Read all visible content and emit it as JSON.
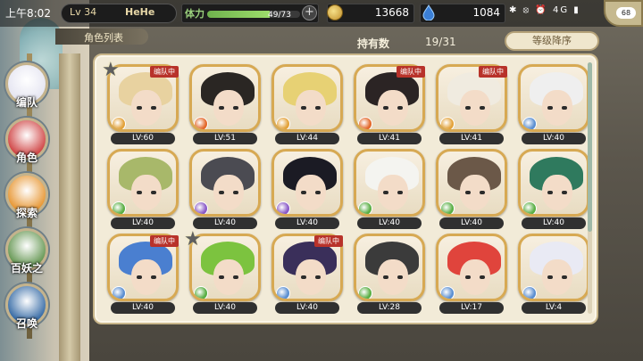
{
  "status_bar": {
    "time": "上午8:02",
    "indicators": "✱ ⦻ ⏰ 4G ▮",
    "battery": "68"
  },
  "player": {
    "level": "Lv 34",
    "name": "HeHe"
  },
  "stamina": {
    "label": "体力",
    "value": "49/73",
    "fraction": 0.67
  },
  "currency": {
    "gold": "13668",
    "gems": "1084"
  },
  "header": {
    "tab": "角色列表",
    "owned_label": "持有数",
    "owned_value": "19/31",
    "sort_button": "等级降序"
  },
  "sidebar": {
    "items": [
      {
        "label": "编队",
        "icon": "team-icon",
        "color": "#e6e6f2"
      },
      {
        "label": "角色",
        "icon": "character-icon",
        "color": "#d14a4a"
      },
      {
        "label": "探索",
        "icon": "explore-icon",
        "color": "#e89a3a"
      },
      {
        "label": "百妖之",
        "icon": "bestiary-icon",
        "color": "#6a9a58"
      },
      {
        "label": "召唤",
        "icon": "summon-icon",
        "color": "#3c6fa8"
      }
    ]
  },
  "characters": [
    {
      "level": "LV:60",
      "badge": "编队中",
      "hair": "#e8d2a0",
      "element": "#e3a23a",
      "frame": "#d7a953"
    },
    {
      "level": "LV:51",
      "badge": "",
      "hair": "#2a2623",
      "element": "#e3692b",
      "frame": "#d7a953"
    },
    {
      "level": "LV:44",
      "badge": "",
      "hair": "#e7d174",
      "element": "#e3a23a",
      "frame": "#d7a953"
    },
    {
      "level": "LV:41",
      "badge": "编队中",
      "hair": "#2b2424",
      "element": "#e3692b",
      "frame": "#d7a953"
    },
    {
      "level": "LV:41",
      "badge": "编队中",
      "hair": "#f0ebe0",
      "element": "#e3a23a",
      "frame": "#d7a953"
    },
    {
      "level": "LV:40",
      "badge": "",
      "hair": "#efefef",
      "element": "#5b8fd1",
      "frame": "#d7a953"
    },
    {
      "level": "LV:40",
      "badge": "",
      "hair": "#a8b86a",
      "element": "#5aaf45",
      "frame": "#d7a953"
    },
    {
      "level": "LV:40",
      "badge": "",
      "hair": "#4b4b52",
      "element": "#8a5ac7",
      "frame": "#d7a953"
    },
    {
      "level": "LV:40",
      "badge": "",
      "hair": "#1b1b24",
      "element": "#8a5ac7",
      "frame": "#d7a953"
    },
    {
      "level": "LV:40",
      "badge": "",
      "hair": "#f4f4f0",
      "element": "#5aaf45",
      "frame": "#d7a953"
    },
    {
      "level": "LV:40",
      "badge": "",
      "hair": "#6b5848",
      "element": "#5aaf45",
      "frame": "#d7a953"
    },
    {
      "level": "LV:40",
      "badge": "",
      "hair": "#2f7a5e",
      "element": "#5aaf45",
      "frame": "#d7a953"
    },
    {
      "level": "LV:40",
      "badge": "编队中",
      "hair": "#4a7fd0",
      "element": "#5b8fd1",
      "frame": "#d7a953"
    },
    {
      "level": "LV:40",
      "badge": "",
      "hair": "#7cc33f",
      "element": "#5aaf45",
      "frame": "#d7a953"
    },
    {
      "level": "LV:40",
      "badge": "编队中",
      "hair": "#3a2f5a",
      "element": "#5b8fd1",
      "frame": "#d7a953"
    },
    {
      "level": "LV:28",
      "badge": "",
      "hair": "#3b3b3b",
      "element": "#5aaf45",
      "frame": "#d7a953"
    },
    {
      "level": "LV:17",
      "badge": "",
      "hair": "#e0443c",
      "element": "#5b8fd1",
      "frame": "#d7a953"
    },
    {
      "level": "LV:4",
      "badge": "",
      "hair": "#e9eaf4",
      "element": "#5b8fd1",
      "frame": "#d7a953"
    }
  ]
}
